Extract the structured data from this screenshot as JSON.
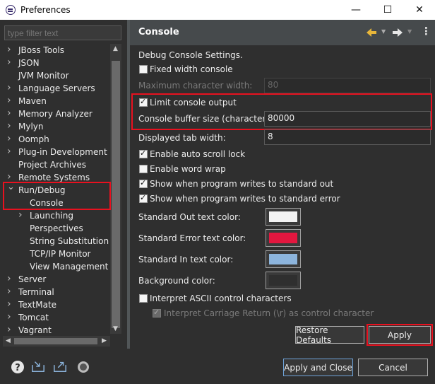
{
  "window": {
    "title": "Preferences"
  },
  "filter": {
    "placeholder": "type filter text"
  },
  "tree": {
    "items": [
      {
        "label": "JBoss Tools",
        "chevron": "right"
      },
      {
        "label": "JSON",
        "chevron": "right"
      },
      {
        "label": "JVM Monitor",
        "chevron": ""
      },
      {
        "label": "Language Servers",
        "chevron": "right"
      },
      {
        "label": "Maven",
        "chevron": "right"
      },
      {
        "label": "Memory Analyzer",
        "chevron": "right"
      },
      {
        "label": "Mylyn",
        "chevron": "right"
      },
      {
        "label": "Oomph",
        "chevron": "right"
      },
      {
        "label": "Plug-in Development",
        "chevron": "right"
      },
      {
        "label": "Project Archives",
        "chevron": ""
      },
      {
        "label": "Remote Systems",
        "chevron": "right"
      },
      {
        "label": "Run/Debug",
        "chevron": "down"
      },
      {
        "label": "Console",
        "chevron": "",
        "selected": true
      },
      {
        "label": "Launching",
        "chevron": "right"
      },
      {
        "label": "Perspectives",
        "chevron": ""
      },
      {
        "label": "String Substitution",
        "chevron": ""
      },
      {
        "label": "TCP/IP Monitor",
        "chevron": ""
      },
      {
        "label": "View Management",
        "chevron": ""
      },
      {
        "label": "Server",
        "chevron": "right"
      },
      {
        "label": "Terminal",
        "chevron": "right"
      },
      {
        "label": "TextMate",
        "chevron": "right"
      },
      {
        "label": "Tomcat",
        "chevron": "right"
      },
      {
        "label": "Vagrant",
        "chevron": "right"
      }
    ]
  },
  "page": {
    "title": "Console",
    "description": "Debug Console Settings.",
    "fixed_width": {
      "label": "Fixed width console",
      "checked": false
    },
    "max_width": {
      "label": "Maximum character width:",
      "value": "80"
    },
    "limit_output": {
      "label": "Limit console output",
      "checked": true
    },
    "buffer_size": {
      "label": "Console buffer size (characters):",
      "value": "80000"
    },
    "tab_width": {
      "label": "Displayed tab width:",
      "value": "8"
    },
    "auto_scroll": {
      "label": "Enable auto scroll lock",
      "checked": true
    },
    "word_wrap": {
      "label": "Enable word wrap",
      "checked": false
    },
    "show_out": {
      "label": "Show when program writes to standard out",
      "checked": true
    },
    "show_err": {
      "label": "Show when program writes to standard error",
      "checked": true
    },
    "out_color": {
      "label": "Standard Out text color:",
      "color": "#f2f2f2"
    },
    "err_color": {
      "label": "Standard Error text color:",
      "color": "#e3173f"
    },
    "in_color": {
      "label": "Standard In text color:",
      "color": "#8cb4dc"
    },
    "bg_color": {
      "label": "Background color:",
      "color": "#2f2f2f"
    },
    "ascii": {
      "label": "Interpret ASCII control characters",
      "checked": false
    },
    "carriage": {
      "label": "Interpret Carriage Return (\\r) as control character",
      "checked": true
    }
  },
  "buttons": {
    "restore": "Restore Defaults",
    "apply": "Apply",
    "apply_close": "Apply and Close",
    "cancel": "Cancel"
  },
  "icons": {
    "help": "help-icon",
    "import": "import-icon",
    "export": "export-icon",
    "oomph": "record-icon",
    "back": "back-arrow-icon",
    "forward": "forward-arrow-icon",
    "menu": "view-menu-icon"
  },
  "colors": {
    "highlight": "#e8111f",
    "back_arrow": "#e8b63a"
  }
}
